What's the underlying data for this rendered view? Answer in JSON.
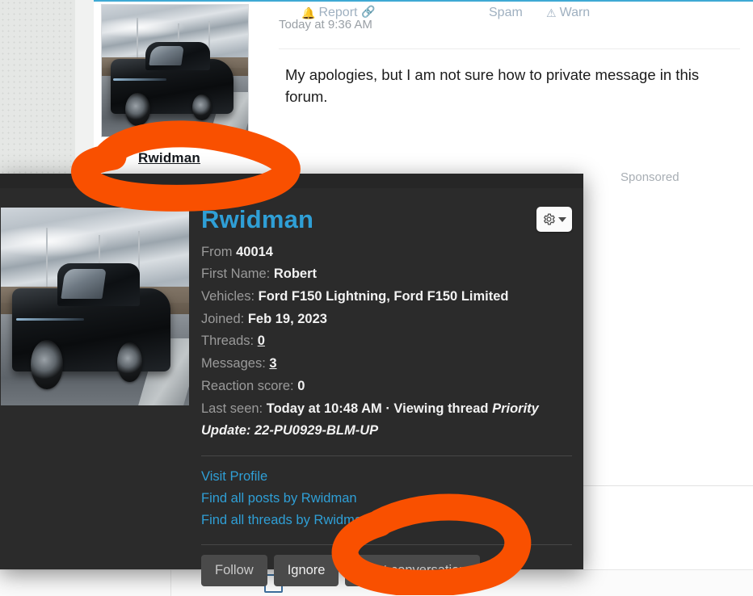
{
  "message": {
    "timestamp": "Today at 9:36 AM",
    "text": "My apologies, but I am not sure how to private message in this forum.",
    "author_name": "Rwidman",
    "avatar_alt": "black-ford-f150-lightning-truck-photo"
  },
  "sidebar": {
    "sponsored_label": "Sponsored"
  },
  "action_bar": {
    "report_label": "Report",
    "report_icon": "bell-icon",
    "link_label": "",
    "link_icon": "link-icon",
    "spam_label": "Spam",
    "warn_label": "Warn",
    "warn_icon": "warning-triangle-icon",
    "checkbox_icon": "checkbox-unchecked"
  },
  "popup": {
    "username": "Rwidman",
    "gear_icon": "gear-icon",
    "caret_icon": "chevron-down-icon",
    "avatar_alt": "black-ford-f150-lightning-truck-photo",
    "fields": {
      "from_label": "From",
      "from_value": "40014",
      "first_name_label": "First Name:",
      "first_name_value": "Robert",
      "vehicles_label": "Vehicles:",
      "vehicles_value": "Ford F150 Lightning, Ford F150 Limited",
      "joined_label": "Joined:",
      "joined_value": "Feb 19, 2023",
      "threads_label": "Threads:",
      "threads_value": "0",
      "messages_label": "Messages:",
      "messages_value": "3",
      "reaction_label": "Reaction score:",
      "reaction_value": "0",
      "last_seen_label": "Last seen:",
      "last_seen_value": "Today at 10:48 AM · Viewing thread ",
      "last_seen_thread": "Priority Update: 22-PU0929-BLM-UP"
    },
    "links": [
      "Visit Profile",
      "Find all posts by Rwidman",
      "Find all threads by Rwidman"
    ],
    "buttons": [
      "Follow",
      "Ignore",
      "Start conversation"
    ]
  },
  "annotations": {
    "color": "#f95000",
    "marks": [
      "circle-around-username-link",
      "circle-around-start-conversation-button"
    ]
  },
  "colors": {
    "accent_blue": "#2f9fd6",
    "popup_bg": "#2b2b2b",
    "annotation_orange": "#f95000",
    "top_rule_blue": "#3fa9d4"
  }
}
